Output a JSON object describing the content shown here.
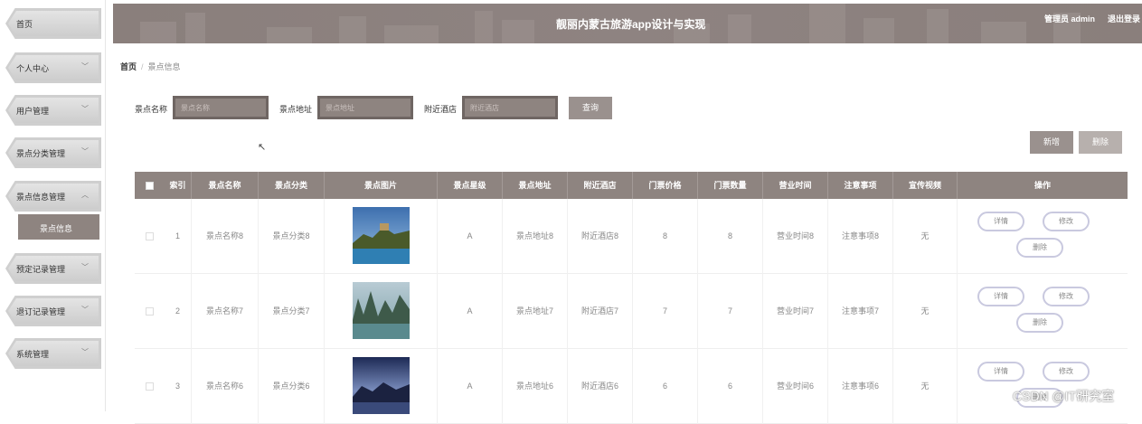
{
  "sidebar": {
    "items": [
      {
        "label": "首页",
        "has_chevron": false
      },
      {
        "label": "个人中心",
        "has_chevron": true
      },
      {
        "label": "用户管理",
        "has_chevron": true
      },
      {
        "label": "景点分类管理",
        "has_chevron": true
      },
      {
        "label": "景点信息管理",
        "has_chevron": true,
        "expanded": true
      },
      {
        "label": "预定记录管理",
        "has_chevron": true
      },
      {
        "label": "退订记录管理",
        "has_chevron": true
      },
      {
        "label": "系统管理",
        "has_chevron": true
      }
    ],
    "submenu_active": "景点信息",
    "chevron_down": "﹀",
    "chevron_up": "︿"
  },
  "header": {
    "title": "靓丽内蒙古旅游app设计与实现",
    "user": "管理员 admin",
    "logout": "退出登录"
  },
  "breadcrumb": {
    "home": "首页",
    "separator": "/",
    "current": "景点信息"
  },
  "search": {
    "fields": [
      {
        "label": "景点名称",
        "placeholder": "景点名称"
      },
      {
        "label": "景点地址",
        "placeholder": "景点地址"
      },
      {
        "label": "附近酒店",
        "placeholder": "附近酒店"
      }
    ],
    "query_button": "查询"
  },
  "toolbar": {
    "add_button": "新增",
    "delete_button": "删除"
  },
  "table": {
    "columns": [
      "索引",
      "景点名称",
      "景点分类",
      "景点图片",
      "景点星级",
      "景点地址",
      "附近酒店",
      "门票价格",
      "门票数量",
      "营业时间",
      "注意事项",
      "宣传视频",
      "操作"
    ],
    "rows": [
      {
        "index": "1",
        "name": "景点名称8",
        "category": "景点分类8",
        "image": "lake-pavilion",
        "star": "A",
        "address": "景点地址8",
        "hotel": "附近酒店8",
        "price": "8",
        "count": "8",
        "hours": "营业时间8",
        "notes": "注意事项8",
        "video": "无"
      },
      {
        "index": "2",
        "name": "景点名称7",
        "category": "景点分类7",
        "image": "karst-river",
        "star": "A",
        "address": "景点地址7",
        "hotel": "附近酒店7",
        "price": "7",
        "count": "7",
        "hours": "营业时间7",
        "notes": "注意事项7",
        "video": "无"
      },
      {
        "index": "3",
        "name": "景点名称6",
        "category": "景点分类6",
        "image": "mountain-dusk",
        "star": "A",
        "address": "景点地址6",
        "hotel": "附近酒店6",
        "price": "6",
        "count": "6",
        "hours": "营业时间6",
        "notes": "注意事项6",
        "video": "无"
      }
    ],
    "actions": {
      "detail": "详情",
      "edit": "修改",
      "delete": "删除"
    }
  },
  "watermark": "CSDN @IT研究室",
  "colors": {
    "accent": "#8e8480",
    "header": "#8a7f7c",
    "button": "#9a918e"
  }
}
